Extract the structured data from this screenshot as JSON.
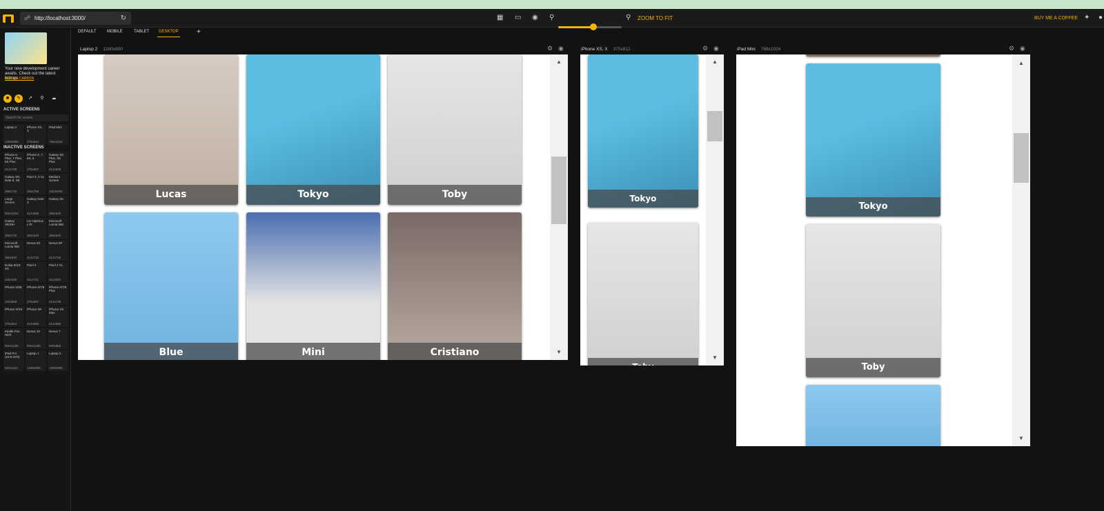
{
  "toolbar": {
    "url": "http://localhost:3000/",
    "zoom_to_fit": "ZOOM TO FIT",
    "buy_coffee": "BUY ME A COFFEE",
    "zoom_level_fraction": 0.55
  },
  "sidebar": {
    "ad_text": "Your new development career awaits. Check out the latest listings.",
    "ad_link": "ADS VIA CARBON",
    "active_title": "ACTIVE SCREENS",
    "search_placeholder": "Search for screen",
    "inactive_title": "INACTIVE SCREENS",
    "active": [
      {
        "name": "Laptop 2",
        "dim": "1280x800"
      },
      {
        "name": "iPhone XS, X",
        "dim": "375x812"
      },
      {
        "name": "iPad Mini",
        "dim": "768x1024"
      }
    ],
    "inactive": [
      {
        "name": "iPhone 8 Plus, 7 Plus, 6S Plus",
        "dim": "414x736"
      },
      {
        "name": "iPhone 8, 7, 6S, 6",
        "dim": "375x667"
      },
      {
        "name": "Galaxy S9 Plus, S8 Plus",
        "dim": "412x846"
      },
      {
        "name": "Galaxy S9, Note 8, S8",
        "dim": "360x740"
      },
      {
        "name": "Pixel 3, 3 XL",
        "dim": "393x786"
      },
      {
        "name": "Medium Screen",
        "dim": "1024x600"
      },
      {
        "name": "Large Screen",
        "dim": "800x1024"
      },
      {
        "name": "Galaxy Note 3",
        "dim": "414x896"
      },
      {
        "name": "Galaxy S5",
        "dim": "360x640"
      },
      {
        "name": "Galaxy S9/S8+",
        "dim": "360x740"
      },
      {
        "name": "LG Optimus L70",
        "dim": "384x640"
      },
      {
        "name": "Microsoft Lumia 550",
        "dim": "360x640"
      },
      {
        "name": "Microsoft Lumia 950",
        "dim": "360x640"
      },
      {
        "name": "Nexus 5X",
        "dim": "412x732"
      },
      {
        "name": "Nexus 6P",
        "dim": "412x732"
      },
      {
        "name": "Nokia 8110 4G",
        "dim": "240x320"
      },
      {
        "name": "Pixel 2",
        "dim": "411x731"
      },
      {
        "name": "Pixel 2 XL",
        "dim": "411x823"
      },
      {
        "name": "iPhone 5/SE",
        "dim": "320x568"
      },
      {
        "name": "iPhone 6/7/8",
        "dim": "375x667"
      },
      {
        "name": "iPhone 6/7/8 Plus",
        "dim": "414x736"
      },
      {
        "name": "iPhone X/XS",
        "dim": "375x812"
      },
      {
        "name": "iPhone XR",
        "dim": "414x896"
      },
      {
        "name": "iPhone XS Max",
        "dim": "414x896"
      },
      {
        "name": "Kindle Fire HDX",
        "dim": "800x1280"
      },
      {
        "name": "Nexus 10",
        "dim": "800x1280"
      },
      {
        "name": "Nexus 7",
        "dim": "600x960"
      },
      {
        "name": "iPad Pro (10.5-inch)",
        "dim": "834x1112"
      },
      {
        "name": "Laptop 1",
        "dim": "1440x900"
      },
      {
        "name": "Laptop 3",
        "dim": "1280x960"
      }
    ]
  },
  "tabs": [
    "DEFAULT",
    "MOBILE",
    "TABLET",
    "DESKTOP"
  ],
  "devices": [
    {
      "name": "Laptop 2",
      "dim": "1280x800"
    },
    {
      "name": "iPhone XS, X",
      "dim": "375x812"
    },
    {
      "name": "iPad Mini",
      "dim": "768x1024"
    }
  ],
  "pets": {
    "lucas": "Lucas",
    "tokyo": "Tokyo",
    "toby": "Toby",
    "blue": "Blue",
    "mini": "Mini",
    "cristiano": "Cristiano"
  },
  "colors": {
    "accent": "#f5b400",
    "background": "#121212",
    "sky": "#5bbde2",
    "photo_grey": "#dcdcdc"
  }
}
